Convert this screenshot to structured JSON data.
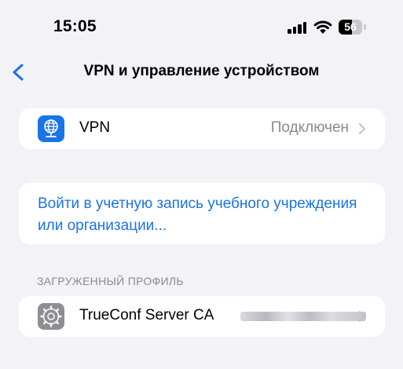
{
  "status_bar": {
    "time": "15:05",
    "battery_percent": "56",
    "battery_level": 0.56,
    "icons": [
      "signal-bars-icon",
      "wifi-icon",
      "battery-icon"
    ]
  },
  "nav": {
    "back_icon": "chevron-left-icon",
    "title": "VPN и управление устройством"
  },
  "vpn_row": {
    "icon": "globe-network-icon",
    "icon_bg": "#1a73e8",
    "label": "VPN",
    "value": "Подключен",
    "chevron": "chevron-right-icon"
  },
  "signin_link": {
    "text": "Войти в учетную запись учебного учреждения или организации..."
  },
  "profile_section": {
    "header": "ЗАГРУЖЕННЫЙ ПРОФИЛЬ",
    "items": [
      {
        "icon": "gear-icon",
        "icon_bg": "#8e8e93",
        "label": "TrueConf Server CA",
        "redacted": true,
        "chevron": "chevron-right-icon"
      }
    ]
  },
  "colors": {
    "background": "#f2f2f7",
    "accent": "#1a73e8",
    "secondary_text": "#8a8a8e"
  }
}
